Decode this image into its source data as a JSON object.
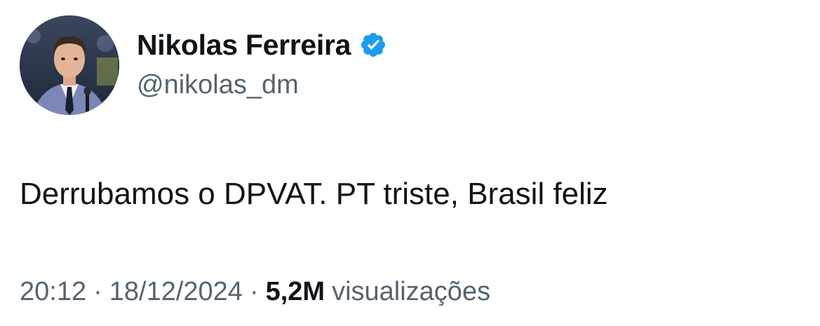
{
  "author": {
    "display_name": "Nikolas Ferreira",
    "handle": "@nikolas_dm",
    "verified_badge_icon": "verified-check-icon",
    "badge_color": "#1d9bf0"
  },
  "tweet": {
    "text": "Derrubamos o DPVAT. PT triste, Brasil feliz",
    "time": "20:12",
    "date": "18/12/2024",
    "separator": "·",
    "views_count": "5,2M",
    "views_label": "visualizações"
  },
  "colors": {
    "text_primary": "#0f1419",
    "text_secondary": "#536471",
    "background": "#ffffff"
  }
}
